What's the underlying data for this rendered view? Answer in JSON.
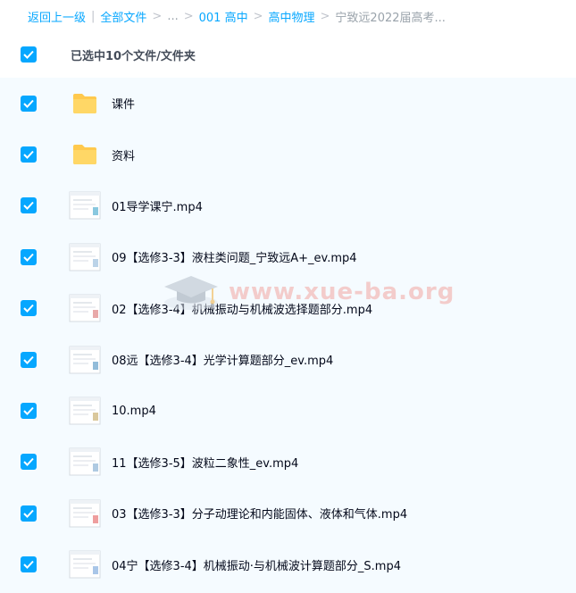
{
  "breadcrumb": {
    "back": "返回上一级",
    "all_files": "全部文件",
    "ellipsis": "...",
    "level1": "001 高中",
    "level2": "高中物理",
    "current": "宁致远2022届高考...",
    "separator": ">",
    "divider": "|"
  },
  "selection": {
    "label": "已选中10个文件/文件夹"
  },
  "files": [
    {
      "name": "课件",
      "type": "folder"
    },
    {
      "name": "资料",
      "type": "folder"
    },
    {
      "name": "01导学课宁.mp4",
      "type": "video"
    },
    {
      "name": "09【选修3-3】液柱类问题_宁致远A+_ev.mp4",
      "type": "video"
    },
    {
      "name": "02【选修3-4】机械振动与机械波选择题部分.mp4",
      "type": "video"
    },
    {
      "name": "08远【选修3-4】光学计算题部分_ev.mp4",
      "type": "video"
    },
    {
      "name": "10.mp4",
      "type": "video"
    },
    {
      "name": "11【选修3-5】波粒二象性_ev.mp4",
      "type": "video"
    },
    {
      "name": "03【选修3-3】分子动理论和内能固体、液体和气体.mp4",
      "type": "video"
    },
    {
      "name": "04宁【选修3-4】机械振动·与机械波计算题部分_S.mp4",
      "type": "video"
    }
  ],
  "watermark": "www.xue-ba.org",
  "colors": {
    "accent": "#06a7ff",
    "folder": "#ffc94d",
    "list_bg": "#f5fbff",
    "watermark": "#f2a7a2"
  }
}
